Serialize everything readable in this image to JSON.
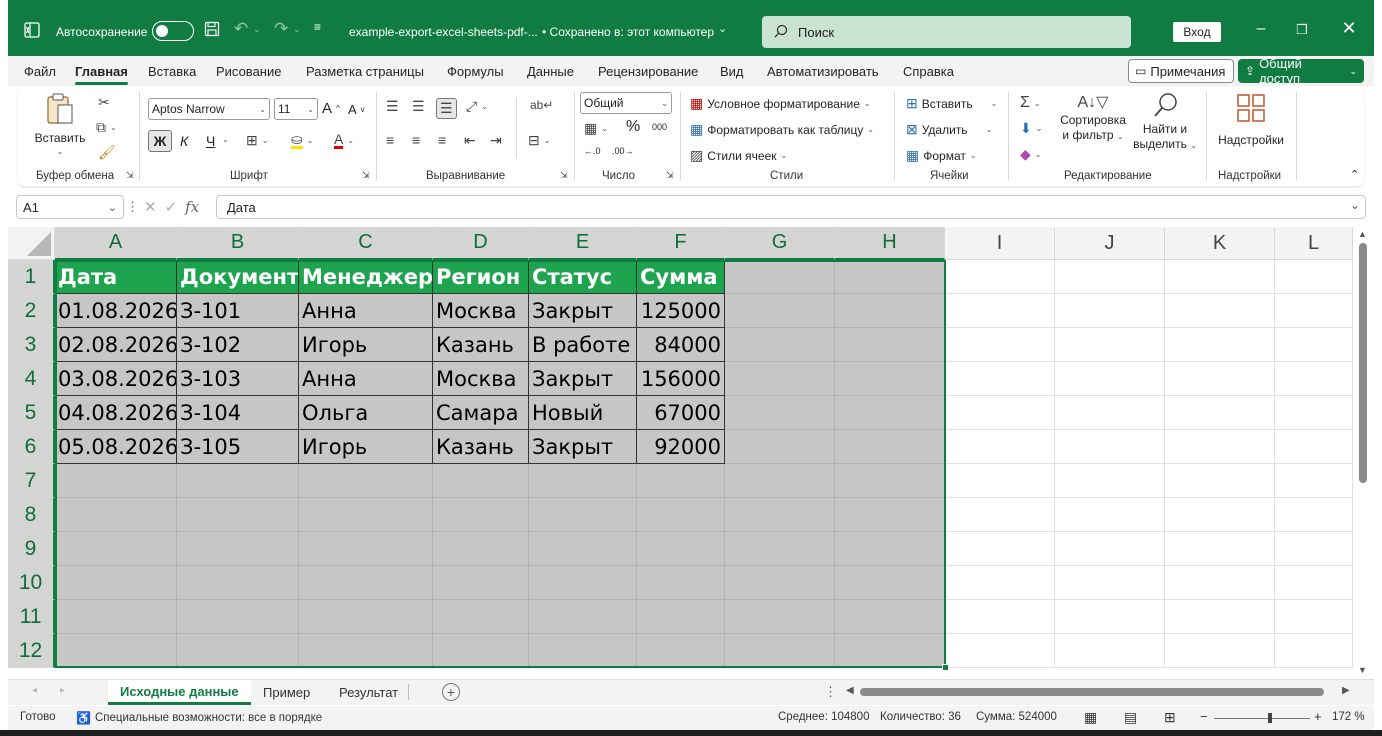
{
  "titlebar": {
    "autosave_label": "Автосохранение",
    "filename": "example-export-excel-sheets-pdf-...",
    "saved_status": "• Сохранено в: этот компьютер",
    "search_placeholder": "Поиск",
    "login_label": "Вход"
  },
  "menu": {
    "tabs": [
      "Файл",
      "Главная",
      "Вставка",
      "Рисование",
      "Разметка страницы",
      "Формулы",
      "Данные",
      "Рецензирование",
      "Вид",
      "Автоматизировать",
      "Справка"
    ],
    "comments_label": "Примечания",
    "share_label": "Общий доступ"
  },
  "ribbon": {
    "clipboard": {
      "paste_label": "Вставить",
      "group_label": "Буфер обмена"
    },
    "font": {
      "font_name": "Aptos Narrow",
      "font_size": "11",
      "bold": "Ж",
      "italic": "К",
      "underline": "Ч",
      "group_label": "Шрифт"
    },
    "alignment": {
      "group_label": "Выравнивание"
    },
    "number": {
      "format": "Общий",
      "percent": "%",
      "thousands": "000",
      "group_label": "Число"
    },
    "styles": {
      "conditional": "Условное форматирование",
      "format_table": "Форматировать как таблицу",
      "cell_styles": "Стили ячеек",
      "group_label": "Стили"
    },
    "cells": {
      "insert": "Вставить",
      "delete": "Удалить",
      "format": "Формат",
      "group_label": "Ячейки"
    },
    "editing": {
      "sort_line1": "Сортировка",
      "sort_line2": "и фильтр",
      "find_line1": "Найти и",
      "find_line2": "выделить",
      "group_label": "Редактирование"
    },
    "addins": {
      "label": "Надстройки",
      "group_label": "Надстройки"
    }
  },
  "formula_bar": {
    "cell_ref": "A1",
    "fx": "fx",
    "content": "Дата"
  },
  "grid": {
    "columns": [
      "A",
      "B",
      "C",
      "D",
      "E",
      "F",
      "G",
      "H",
      "I",
      "J",
      "K",
      "L"
    ],
    "rows": [
      "1",
      "2",
      "3",
      "4",
      "5",
      "6",
      "7",
      "8",
      "9",
      "10",
      "11",
      "12"
    ],
    "header": [
      "Дата",
      "Документ",
      "Менеджер",
      "Регион",
      "Статус",
      "Сумма"
    ],
    "data": [
      [
        "01.08.2026",
        "З-101",
        "Анна",
        "Москва",
        "Закрыт",
        "125000"
      ],
      [
        "02.08.2026",
        "З-102",
        "Игорь",
        "Казань",
        "В работе",
        "84000"
      ],
      [
        "03.08.2026",
        "З-103",
        "Анна",
        "Москва",
        "Закрыт",
        "156000"
      ],
      [
        "04.08.2026",
        "З-104",
        "Ольга",
        "Самара",
        "Новый",
        "67000"
      ],
      [
        "05.08.2026",
        "З-105",
        "Игорь",
        "Казань",
        "Закрыт",
        "92000"
      ]
    ],
    "header_color": "#1ea44f",
    "selection_color": "#107c41"
  },
  "sheets": {
    "tabs": [
      "Исходные данные",
      "Пример",
      "Результат"
    ],
    "active": 0
  },
  "statusbar": {
    "ready": "Готово",
    "accessibility": "Специальные возможности: все в порядке",
    "average": "Среднее: 104800",
    "count": "Количество: 36",
    "sum": "Сумма: 524000",
    "zoom": "172 %"
  }
}
